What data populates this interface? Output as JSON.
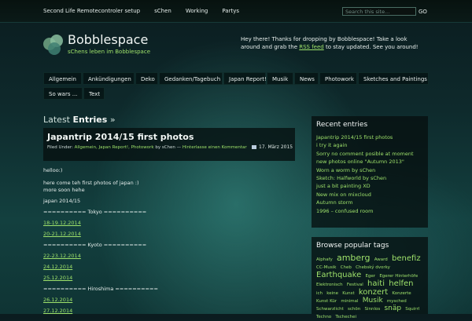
{
  "topnav": [
    "Second Life Remotecontroler setup",
    "sChen",
    "Working",
    "Partys"
  ],
  "search": {
    "placeholder": "Search this site...",
    "button": "GO"
  },
  "site": {
    "title": "Bobblespace",
    "description": "sChens leben im Bobblespace"
  },
  "welcome": {
    "before": "Hey there! Thanks for dropping by Bobblespace! Take a look around and grab the",
    "link": "RSS feed",
    "after": "to stay updated. See you around!"
  },
  "mainnav": [
    {
      "label": "Allgemein"
    },
    {
      "label": "Ankündigungen"
    },
    {
      "label": "Deko"
    },
    {
      "label": "Gedanken/Tagebuch"
    },
    {
      "label": "Japan Report!"
    },
    {
      "label": "Musik"
    },
    {
      "label": "News"
    },
    {
      "label": "Photowork"
    },
    {
      "label": "Sketches and Paintings"
    },
    {
      "label": "So wars ..."
    },
    {
      "label": "Text"
    }
  ],
  "latest": {
    "label": "Latest",
    "strong": "Entries",
    "arrow": "»"
  },
  "post": {
    "title": "Japantrip 2014/15 first photos",
    "date": "17. März 2015",
    "filed_label": "Filed Under:",
    "categories": "Allgemein, Japan Report!, Photowork",
    "by": "by",
    "author": "sChen",
    "dash": "—",
    "comment": "Hinterlasse einen Kommentar",
    "lines": [
      {
        "text": "helloo:)",
        "link": false
      },
      {
        "text": "here come teh first photos of japan :)",
        "link": false
      },
      {
        "text": "more soon hehe",
        "link": false
      },
      {
        "text": "japan 2014/15",
        "link": false
      },
      {
        "text": "========== Tokyo ==========",
        "link": false
      },
      {
        "text": "18-19.12.2014",
        "link": true
      },
      {
        "text": "20-21.12.2014",
        "link": true
      },
      {
        "text": "========== Kyoto ==========",
        "link": false
      },
      {
        "text": "22-23.12.2014",
        "link": true
      },
      {
        "text": "24.12.2014",
        "link": true
      },
      {
        "text": "25.12.2014",
        "link": true
      },
      {
        "text": "========== Hiroshima ==========",
        "link": false
      },
      {
        "text": "26.12.2014",
        "link": true
      },
      {
        "text": "27.12.2014",
        "link": true
      }
    ]
  },
  "recent": {
    "title": "Recent entries",
    "items": [
      "Japantrip 2014/15 first photos",
      "i try it again",
      "Sorry no comment posible at moment",
      "new photos online \"Autumn 2013\"",
      "Worn a worm by sChen",
      "Sketch: Halfworld by sChen",
      "just a bit painting XD",
      "New mix on mixcloud",
      "Autumn storm",
      "1996 – confused room"
    ]
  },
  "tags": {
    "title": "Browse popular tags",
    "items": [
      {
        "t": "Alphafy",
        "s": 5.5
      },
      {
        "t": "amberg",
        "s": 11
      },
      {
        "t": "Award",
        "s": 5.5
      },
      {
        "t": "benefiz",
        "s": 10
      },
      {
        "t": "CC-Musik",
        "s": 5.5
      },
      {
        "t": "Cheb",
        "s": 5.5
      },
      {
        "t": "Chebský dvorky",
        "s": 5.5
      },
      {
        "t": "Earthquake",
        "s": 10
      },
      {
        "t": "Eger",
        "s": 5.5
      },
      {
        "t": "Egerer Hinterhöfe",
        "s": 5.5
      },
      {
        "t": "Elektronisch",
        "s": 5.5
      },
      {
        "t": "Festival",
        "s": 5.5
      },
      {
        "t": "haiti",
        "s": 10
      },
      {
        "t": "helfen",
        "s": 10
      },
      {
        "t": "ich",
        "s": 5.5
      },
      {
        "t": "keine",
        "s": 5.5
      },
      {
        "t": "Kunst",
        "s": 5.5
      },
      {
        "t": "konzert",
        "s": 10
      },
      {
        "t": "Konzerte",
        "s": 5.5
      },
      {
        "t": "Kunst Kür",
        "s": 5.5
      },
      {
        "t": "minimal",
        "s": 5.5
      },
      {
        "t": "Musik",
        "s": 9
      },
      {
        "t": "mysched",
        "s": 5.5
      },
      {
        "t": "Schwarzlicht",
        "s": 5.5
      },
      {
        "t": "schön",
        "s": 5.5
      },
      {
        "t": "Sinnlos",
        "s": 5.5
      },
      {
        "t": "snäp",
        "s": 9
      },
      {
        "t": "Squirrl",
        "s": 5.5
      },
      {
        "t": "Techno",
        "s": 5.5
      },
      {
        "t": "Tschechei",
        "s": 5.5
      }
    ]
  }
}
